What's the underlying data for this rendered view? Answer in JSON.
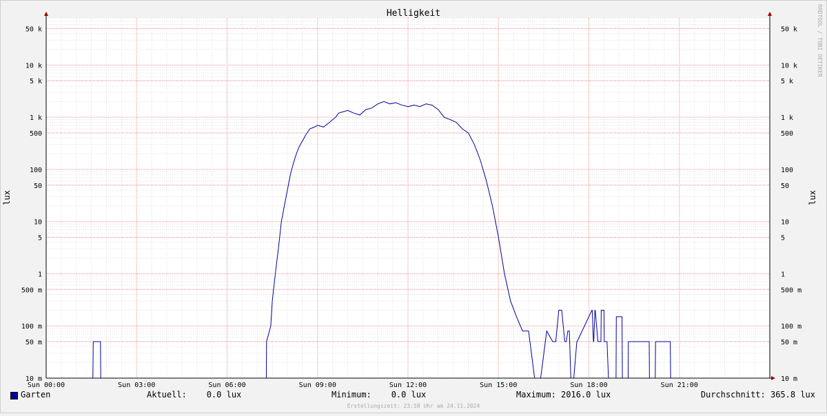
{
  "chart_data": {
    "type": "line",
    "title": "Helligkeit",
    "ylabel": "lux",
    "ylabel_right": "lux",
    "y_scale": "log",
    "ylim": [
      0.01,
      80000
    ],
    "y_ticks": [
      {
        "value": 0.01,
        "label": "10 m"
      },
      {
        "value": 0.05,
        "label": "50 m"
      },
      {
        "value": 0.1,
        "label": "100 m"
      },
      {
        "value": 0.5,
        "label": "500 m"
      },
      {
        "value": 1,
        "label": "1"
      },
      {
        "value": 5,
        "label": "5"
      },
      {
        "value": 10,
        "label": "10"
      },
      {
        "value": 50,
        "label": "50"
      },
      {
        "value": 100,
        "label": "100"
      },
      {
        "value": 500,
        "label": "500"
      },
      {
        "value": 1000,
        "label": "1 k"
      },
      {
        "value": 5000,
        "label": "5 k"
      },
      {
        "value": 10000,
        "label": "10 k"
      },
      {
        "value": 50000,
        "label": "50 k"
      }
    ],
    "x_ticks": [
      {
        "value": 0,
        "label": "Sun 00:00"
      },
      {
        "value": 3,
        "label": "Sun 03:00"
      },
      {
        "value": 6,
        "label": "Sun 06:00"
      },
      {
        "value": 9,
        "label": "Sun 09:00"
      },
      {
        "value": 12,
        "label": "Sun 12:00"
      },
      {
        "value": 15,
        "label": "Sun 15:00"
      },
      {
        "value": 18,
        "label": "Sun 18:00"
      },
      {
        "value": 21,
        "label": "Sun 21:00"
      }
    ],
    "xlim": [
      0,
      24
    ],
    "grid": true,
    "series": [
      {
        "name": "Garten",
        "color": "#00009e",
        "x_hours": [
          0,
          1.55,
          1.56,
          1.8,
          1.81,
          7.3,
          7.31,
          7.45,
          7.5,
          7.6,
          7.7,
          7.8,
          7.9,
          8.0,
          8.1,
          8.2,
          8.3,
          8.4,
          8.5,
          8.6,
          8.75,
          8.9,
          9.0,
          9.2,
          9.4,
          9.6,
          9.7,
          9.9,
          10.0,
          10.2,
          10.4,
          10.6,
          10.8,
          11.0,
          11.2,
          11.4,
          11.6,
          11.8,
          12.0,
          12.2,
          12.4,
          12.6,
          12.8,
          13.0,
          13.2,
          13.4,
          13.6,
          13.8,
          14.0,
          14.2,
          14.4,
          14.6,
          14.8,
          15.0,
          15.2,
          15.4,
          15.6,
          15.8,
          16.0,
          16.2,
          16.4,
          16.6,
          16.8,
          16.9,
          17.0,
          17.1,
          17.2,
          17.25,
          17.3,
          17.35,
          17.4,
          17.5,
          17.6,
          17.61,
          18.1,
          18.11,
          18.15,
          18.16,
          18.2,
          18.21,
          18.3,
          18.4,
          18.41,
          18.5,
          18.51,
          18.6,
          18.65,
          18.7,
          18.71,
          18.9,
          18.91,
          19.1,
          19.11,
          19.3,
          19.31,
          20.0,
          20.01,
          20.2,
          20.21,
          20.7,
          20.71,
          20.9,
          20.91,
          21.6,
          21.61,
          21.8,
          21.81,
          22.6,
          22.61,
          22.7,
          22.71,
          23.1,
          23.11,
          23.15,
          23.16,
          24
        ],
        "values": [
          0.01,
          0.01,
          0.05,
          0.05,
          0.01,
          0.01,
          0.05,
          0.1,
          0.3,
          1,
          3,
          10,
          20,
          40,
          80,
          130,
          200,
          280,
          350,
          450,
          600,
          650,
          700,
          650,
          800,
          1000,
          1200,
          1300,
          1350,
          1200,
          1100,
          1400,
          1500,
          1800,
          2000,
          1800,
          1900,
          1700,
          1600,
          1700,
          1600,
          1800,
          1700,
          1400,
          1000,
          900,
          800,
          600,
          500,
          300,
          150,
          60,
          20,
          5,
          1,
          0.3,
          0.15,
          0.08,
          0.08,
          0.01,
          0.01,
          0.08,
          0.05,
          0.05,
          0.2,
          0.2,
          0.05,
          0.05,
          0.08,
          0.08,
          0.01,
          0.01,
          0.05,
          0.05,
          0.2,
          0.2,
          0.05,
          0.05,
          0.2,
          0.2,
          0.05,
          0.05,
          0.2,
          0.2,
          0.05,
          0.05,
          0.01,
          0.01,
          0.01,
          0.01,
          0.15,
          0.15,
          0.01,
          0.01,
          0.05,
          0.05,
          0.01,
          0.01,
          0.05,
          0.05,
          0.01,
          0.01,
          0.01
        ]
      }
    ]
  },
  "legend": {
    "series_name": "Garten",
    "aktuell": "Aktuell:    0.0 lux",
    "minimum": "Minimum:    0.0 lux",
    "maximum": "Maximum: 2016.0 lux",
    "durchschnitt": "Durchschnitt: 365.8 lux"
  },
  "watermark": "RRDTOOL / TOBI OETIKER",
  "footer": "Erstellungszeit: 23:58 Uhr am 24.11.2024"
}
